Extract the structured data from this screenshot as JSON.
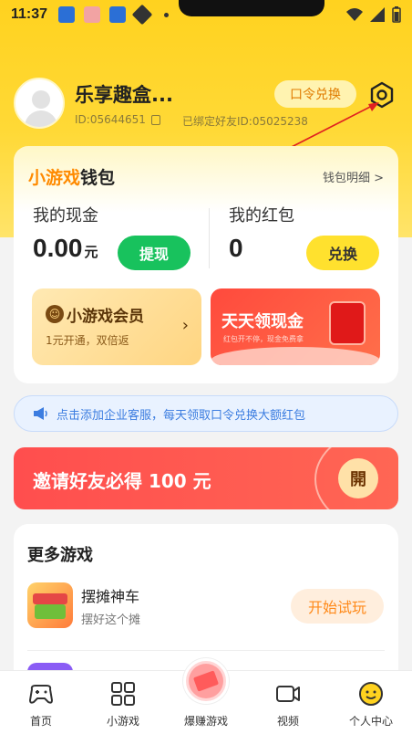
{
  "status_bar": {
    "time": "11:37"
  },
  "header": {
    "username": "乐享趣盒...",
    "user_id": "ID:05644651",
    "bound_friend": "已绑定好友ID:05025238",
    "redeem_label": "口令兑换"
  },
  "wallet": {
    "title_prefix": "小游戏",
    "title_suffix": "钱包",
    "detail_link": "钱包明细 >",
    "cash_label": "我的现金",
    "cash_value": "0.00",
    "cash_unit": "元",
    "withdraw_label": "提现",
    "redpacket_label": "我的红包",
    "redpacket_value": "0",
    "exchange_label": "兑换",
    "vip_title": "小游戏会员",
    "vip_subtitle": "1元开通，双倍返",
    "vip_badge": "☺",
    "daily_cash_title": "天天领现金",
    "daily_cash_subtitle": "红包开不停，现金免费拿"
  },
  "notice": {
    "text": "点击添加企业客服，每天领取口令兑换大额红包"
  },
  "invite": {
    "text": "邀请好友必得 100 元",
    "open_label": "開"
  },
  "more_games": {
    "title": "更多游戏",
    "items": [
      {
        "name": "摆摊神车",
        "desc": "摆好这个摊",
        "action": "开始试玩"
      }
    ]
  },
  "bottom_nav": {
    "items": [
      {
        "label": "首页"
      },
      {
        "label": "小游戏"
      },
      {
        "label": "爆赚游戏"
      },
      {
        "label": "视频"
      },
      {
        "label": "个人中心"
      }
    ]
  },
  "colors": {
    "brand_yellow": "#ffd21f",
    "green": "#18c25d",
    "red": "#ff4e4e",
    "orange": "#ff8a00"
  }
}
